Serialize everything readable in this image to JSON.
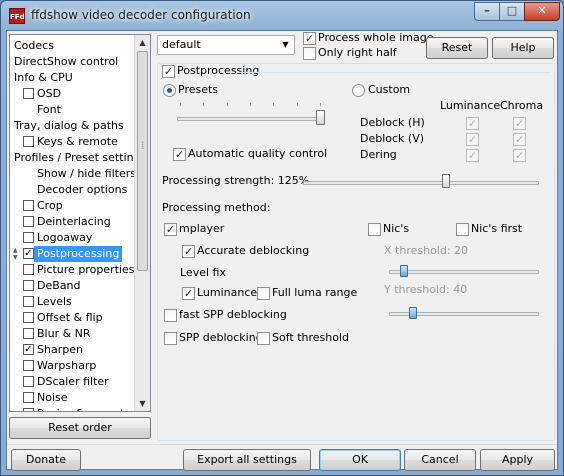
{
  "window": {
    "title": "ffdshow video decoder configuration",
    "app_icon": "FFd",
    "caption": {
      "minimize": "–",
      "maximize": "□",
      "close": "✕"
    }
  },
  "tree": {
    "items": [
      {
        "label": "Codecs",
        "indent": 0,
        "checkbox": false
      },
      {
        "label": "DirectShow control",
        "indent": 0,
        "checkbox": false
      },
      {
        "label": "Info & CPU",
        "indent": 0,
        "checkbox": false
      },
      {
        "label": "OSD",
        "indent": 1,
        "checkbox": true,
        "checked": false
      },
      {
        "label": "Font",
        "indent": 2,
        "checkbox": false
      },
      {
        "label": "Tray, dialog & paths",
        "indent": 0,
        "checkbox": false
      },
      {
        "label": "Keys & remote",
        "indent": 1,
        "checkbox": true,
        "checked": false
      },
      {
        "label": "Profiles / Preset settings",
        "indent": 0,
        "checkbox": false
      },
      {
        "label": "Show / hide filters",
        "indent": 2,
        "checkbox": false
      },
      {
        "label": "Decoder options",
        "indent": 2,
        "checkbox": false
      },
      {
        "label": "Crop",
        "indent": 1,
        "checkbox": true,
        "checked": false
      },
      {
        "label": "Deinterlacing",
        "indent": 1,
        "checkbox": true,
        "checked": false
      },
      {
        "label": "Logoaway",
        "indent": 1,
        "checkbox": true,
        "checked": false
      },
      {
        "label": "Postprocessing",
        "indent": 1,
        "checkbox": true,
        "checked": true,
        "selected": true
      },
      {
        "label": "Picture properties",
        "indent": 1,
        "checkbox": true,
        "checked": false
      },
      {
        "label": "DeBand",
        "indent": 1,
        "checkbox": true,
        "checked": false
      },
      {
        "label": "Levels",
        "indent": 1,
        "checkbox": true,
        "checked": false
      },
      {
        "label": "Offset & flip",
        "indent": 1,
        "checkbox": true,
        "checked": false
      },
      {
        "label": "Blur & NR",
        "indent": 1,
        "checkbox": true,
        "checked": false
      },
      {
        "label": "Sharpen",
        "indent": 1,
        "checkbox": true,
        "checked": true
      },
      {
        "label": "Warpsharp",
        "indent": 1,
        "checkbox": true,
        "checked": false
      },
      {
        "label": "DScaler filter",
        "indent": 1,
        "checkbox": true,
        "checked": false
      },
      {
        "label": "Noise",
        "indent": 1,
        "checkbox": true,
        "checked": false
      },
      {
        "label": "Resize & aspect",
        "indent": 1,
        "checkbox": true,
        "checked": false
      }
    ],
    "scroll_up": "▲",
    "scroll_down": "▼",
    "check_mark": "✓"
  },
  "top": {
    "preset_select": "default",
    "dropdown_arrow": "▼",
    "process_whole_image": "Process whole image",
    "process_whole_image_checked": true,
    "only_right_half": "Only right half",
    "only_right_half_checked": false,
    "reset": "Reset",
    "help": "Help"
  },
  "pp": {
    "enable": "Postprocessing",
    "enable_checked": true,
    "presets": "Presets",
    "custom": "Custom",
    "presets_selected": true,
    "preset_level": 6,
    "preset_level_max": 6,
    "auto_quality": "Automatic quality control",
    "auto_quality_checked": true,
    "col_luminance": "Luminance",
    "col_chroma": "Chroma",
    "rows": [
      {
        "label": "Deblock (H)",
        "lum": true,
        "chroma": true
      },
      {
        "label": "Deblock (V)",
        "lum": true,
        "chroma": true
      },
      {
        "label": "Dering",
        "lum": true,
        "chroma": true
      }
    ],
    "strength_label": "Processing strength: 125%",
    "strength_fraction": 0.61,
    "method_label": "Processing method:",
    "mplayer": "mplayer",
    "mplayer_checked": true,
    "nics": "Nic's",
    "nics_checked": false,
    "nics_first": "Nic's first",
    "nics_first_checked": false,
    "accurate_deblocking": "Accurate deblocking",
    "accurate_deblocking_checked": true,
    "x_threshold": "X threshold: 20",
    "x_threshold_fraction": 0.1,
    "level_fix": "Level fix",
    "luminance": "Luminance",
    "luminance_checked": true,
    "full_luma_range": "Full luma range",
    "full_luma_range_checked": false,
    "y_threshold": "Y threshold: 40",
    "y_threshold_fraction": 0.16,
    "fast_spp": "fast SPP deblocking",
    "fast_spp_checked": false,
    "spp": "SPP deblocking",
    "spp_checked": false,
    "soft_threshold": "Soft threshold",
    "soft_threshold_checked": false
  },
  "buttons": {
    "reset_order": "Reset order",
    "donate": "Donate",
    "export_all": "Export all settings",
    "ok": "OK",
    "cancel": "Cancel",
    "apply": "Apply"
  }
}
